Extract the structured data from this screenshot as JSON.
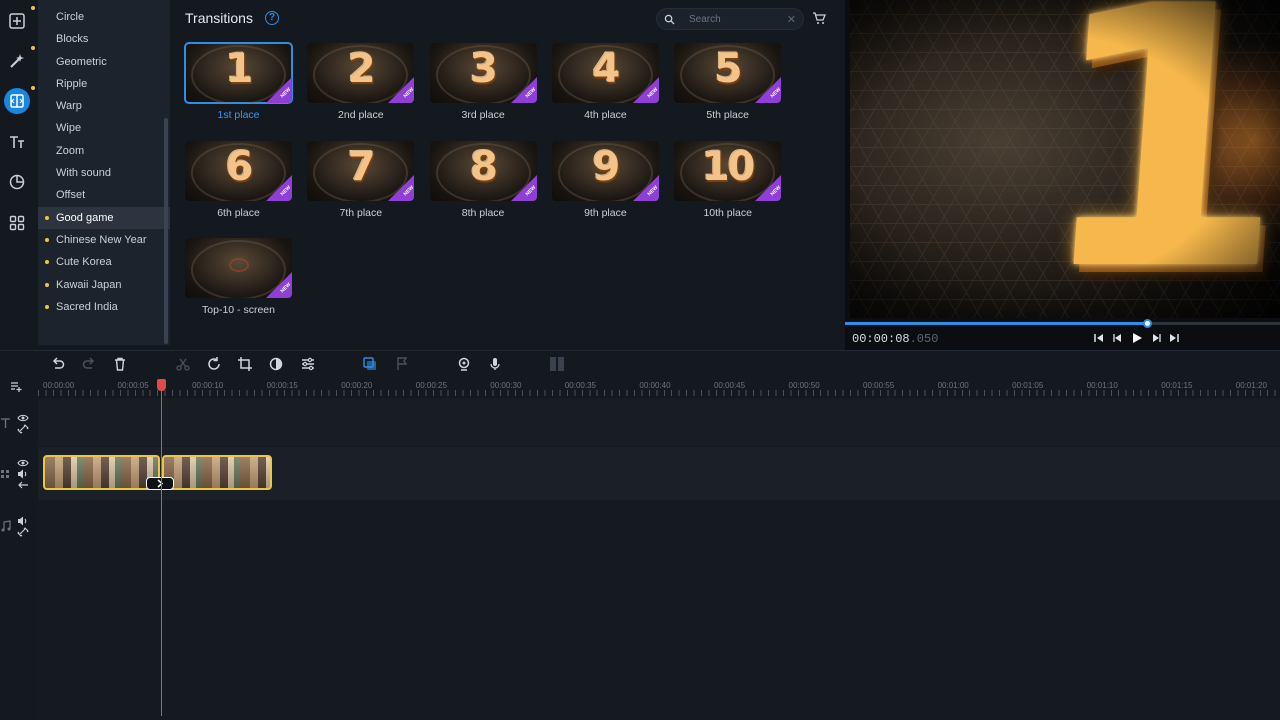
{
  "toolbar": {
    "tools": [
      "import-icon",
      "magic-wand-icon",
      "transitions-icon",
      "titles-icon",
      "stickers-icon",
      "more-tools-icon"
    ]
  },
  "categories": {
    "items": [
      {
        "label": "Circle",
        "dot": false
      },
      {
        "label": "Blocks",
        "dot": false
      },
      {
        "label": "Geometric",
        "dot": false
      },
      {
        "label": "Ripple",
        "dot": false
      },
      {
        "label": "Warp",
        "dot": false
      },
      {
        "label": "Wipe",
        "dot": false
      },
      {
        "label": "Zoom",
        "dot": false
      },
      {
        "label": "With sound",
        "dot": false
      },
      {
        "label": "Offset",
        "dot": false
      },
      {
        "label": "Good game",
        "dot": true,
        "selected": true
      },
      {
        "label": "Chinese New Year",
        "dot": true
      },
      {
        "label": "Cute Korea",
        "dot": true
      },
      {
        "label": "Kawaii Japan",
        "dot": true
      },
      {
        "label": "Sacred India",
        "dot": true
      }
    ]
  },
  "browser": {
    "title": "Transitions",
    "help": "?",
    "search_placeholder": "Search",
    "badge": "NEW",
    "tiles": [
      {
        "glyph": "1",
        "label": "1st place",
        "selected": true
      },
      {
        "glyph": "2",
        "label": "2nd place"
      },
      {
        "glyph": "3",
        "label": "3rd place"
      },
      {
        "glyph": "4",
        "label": "4th place"
      },
      {
        "glyph": "5",
        "label": "5th place"
      },
      {
        "glyph": "6",
        "label": "6th place"
      },
      {
        "glyph": "7",
        "label": "7th place"
      },
      {
        "glyph": "8",
        "label": "8th place"
      },
      {
        "glyph": "9",
        "label": "9th place"
      },
      {
        "glyph": "10",
        "label": "10th place"
      },
      {
        "glyph": "",
        "label": "Top-10 - screen"
      }
    ]
  },
  "preview": {
    "big_glyph": "1",
    "timecode_main": "00:00:08",
    "timecode_ms": ".050",
    "progress_fraction": 0.694
  },
  "timeline": {
    "ruler_labels": [
      "00:00:00",
      "00:00:05",
      "00:00:10",
      "00:00:15",
      "00:00:20",
      "00:00:25",
      "00:00:30",
      "00:00:35",
      "00:00:40",
      "00:00:45",
      "00:00:50",
      "00:00:55",
      "00:01:00",
      "00:01:05",
      "00:01:10",
      "00:01:15",
      "00:01:20"
    ]
  },
  "colors": {
    "accent": "#1a86e0",
    "badge": "#8f3fd6",
    "category_dot": "#f0c24a",
    "clip_border": "#e9c54a",
    "playhead": "#e04a4a"
  }
}
